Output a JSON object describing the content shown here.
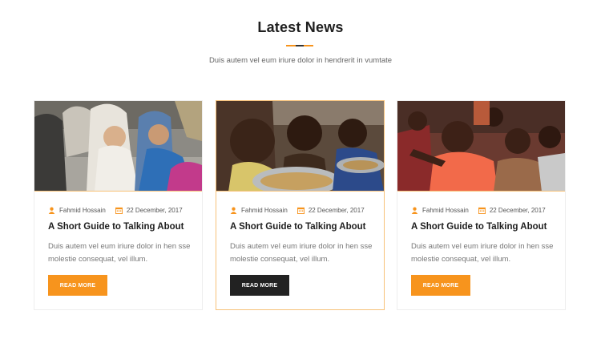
{
  "section": {
    "title": "Latest News",
    "subtitle": "Duis autem vel eum iriure dolor in hendrerit in vumtate"
  },
  "colors": {
    "accent": "#f7941d",
    "dark_button": "#222222"
  },
  "cards": [
    {
      "author": "Fahmid Hossain",
      "date": "22 December, 2017",
      "title": "A Short Guide to Talking About",
      "excerpt": "Duis autem vel eum iriure dolor in hen sse molestie consequat, vel illum.",
      "button": "READ MORE",
      "author_icon": "user-icon",
      "date_icon": "calendar-icon"
    },
    {
      "author": "Fahmid Hossain",
      "date": "22 December, 2017",
      "title": "A Short Guide to Talking About",
      "excerpt": "Duis autem vel eum iriure dolor in hen sse molestie consequat, vel illum.",
      "button": "READ MORE",
      "author_icon": "user-icon",
      "date_icon": "calendar-icon"
    },
    {
      "author": "Fahmid Hossain",
      "date": "22 December, 2017",
      "title": "A Short Guide to Talking About",
      "excerpt": "Duis autem vel eum iriure dolor in hen sse molestie consequat, vel illum.",
      "button": "READ MORE",
      "author_icon": "user-icon",
      "date_icon": "calendar-icon"
    }
  ]
}
